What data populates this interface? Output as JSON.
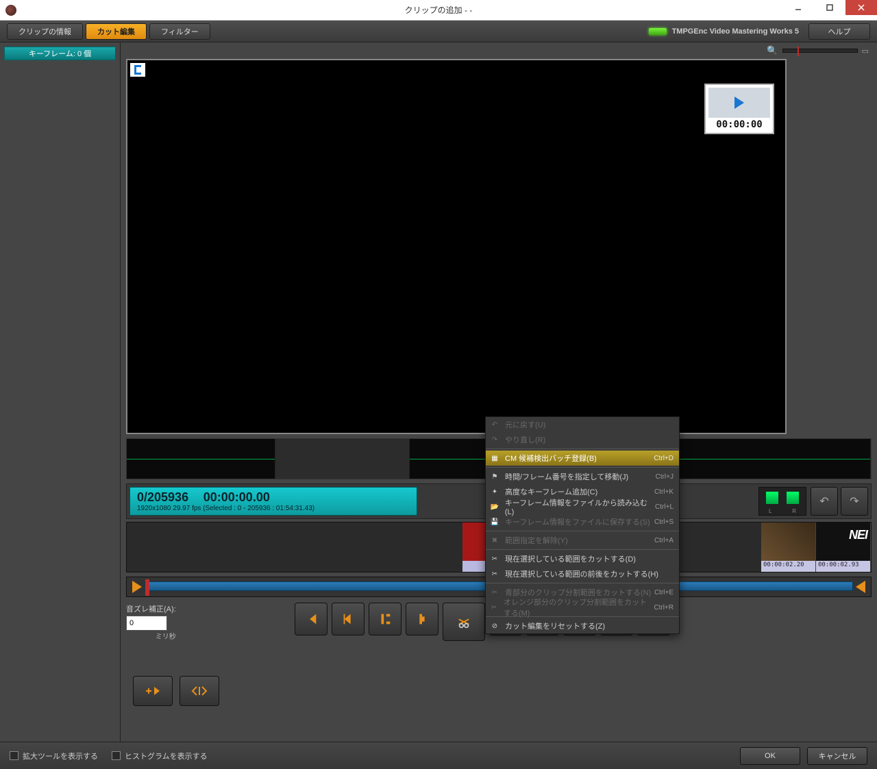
{
  "titlebar": {
    "title": "クリップの追加 -                         -"
  },
  "tabs": {
    "clip_info": "クリップの情報",
    "cut_edit": "カット編集",
    "filter": "フィルター"
  },
  "brand": "TMPGEnc Video Mastering Works 5",
  "help": "ヘルプ",
  "sidebar": {
    "keyframe_header": "キーフレーム: 0 個"
  },
  "pip": {
    "time": "00:00:00"
  },
  "counter": {
    "frames": "0/205936",
    "timecode": "00:00:00.00",
    "detail": "1920x1080 29.97 fps  (Selected : 0 - 205936 : 01:54:31.43)"
  },
  "audio_meter": {
    "left": "L",
    "right": "R"
  },
  "thumbs": [
    {
      "tc": "00:00:02.20"
    },
    {
      "tc": "00:00:02.93"
    }
  ],
  "audio_offset": {
    "label": "音ズレ補正(A):",
    "value": "0",
    "unit": "ミリ秒"
  },
  "context_menu": [
    {
      "label": "元に戻す(U)",
      "shortcut": "",
      "disabled": true,
      "icon": "undo"
    },
    {
      "label": "やり直し(R)",
      "shortcut": "",
      "disabled": true,
      "icon": "redo"
    },
    {
      "sep": true
    },
    {
      "label": "CM 候補検出バッチ登録(B)",
      "shortcut": "Ctrl+D",
      "hl": true,
      "icon": "box"
    },
    {
      "sep": true
    },
    {
      "label": "時間/フレーム番号を指定して移動(J)",
      "shortcut": "Ctrl+J",
      "icon": "flag"
    },
    {
      "label": "高度なキーフレーム追加(C)",
      "shortcut": "Ctrl+K",
      "icon": "key"
    },
    {
      "label": "キーフレーム情報をファイルから読み込む(L)",
      "shortcut": "Ctrl+L",
      "icon": "open"
    },
    {
      "label": "キーフレーム情報をファイルに保存する(S)",
      "shortcut": "Ctrl+S",
      "disabled": true,
      "icon": "save"
    },
    {
      "sep": true
    },
    {
      "label": "範囲指定を解除(Y)",
      "shortcut": "Ctrl+A",
      "disabled": true,
      "icon": "x"
    },
    {
      "sep": true
    },
    {
      "label": "現在選択している範囲をカットする(D)",
      "shortcut": "",
      "icon": "cut"
    },
    {
      "label": "現在選択している範囲の前後をカットする(H)",
      "shortcut": "",
      "icon": "cut"
    },
    {
      "sep": true
    },
    {
      "label": "青部分のクリップ分割範囲をカットする(N)",
      "shortcut": "Ctrl+E",
      "disabled": true,
      "icon": "cutb"
    },
    {
      "label": "オレンジ部分のクリップ分割範囲をカットする(M)",
      "shortcut": "Ctrl+R",
      "disabled": true,
      "icon": "cuto"
    },
    {
      "sep": true
    },
    {
      "label": "カット編集をリセットする(Z)",
      "shortcut": "",
      "icon": "reset"
    }
  ],
  "footer": {
    "zoom_tool": "拡大ツールを表示する",
    "histogram": "ヒストグラムを表示する",
    "ok": "OK",
    "cancel": "キャンセル"
  }
}
